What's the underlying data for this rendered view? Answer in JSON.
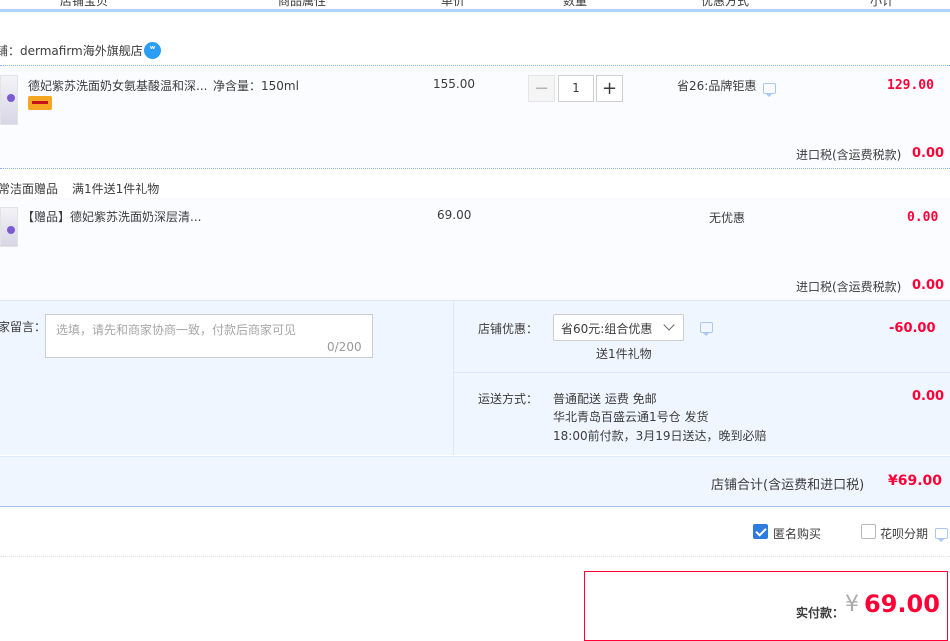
{
  "header": {
    "columns": [
      "店铺宝贝",
      "商品属性",
      "单价",
      "数量",
      "优惠方式",
      "小计"
    ]
  },
  "shop": {
    "label": "铺：dermafirm海外旗舰店",
    "wangwang_icon": "wangwang-chat-icon"
  },
  "items": [
    {
      "title": "德妃紫苏洗面奶女氨基酸温和深...",
      "spec": "净含量：150ml",
      "unit_price": "155.00",
      "quantity": "1",
      "promo": "省26:品牌钜惠",
      "subtotal": "129.00",
      "tax_label": "进口税(含运费税款)",
      "tax_value": "0.00"
    },
    {
      "group_label": "常洁面赠品",
      "group_rule": "满1件送1件礼物",
      "title": "【赠品】德妃紫苏洗面奶深层清...",
      "unit_price": "69.00",
      "promo": "无优惠",
      "subtotal": "0.00",
      "tax_label": "进口税(含运费税款)",
      "tax_value": "0.00"
    }
  ],
  "message": {
    "label": "家留言：",
    "placeholder": "选填，请先和商家协商一致，付款后商家可见",
    "count": "0/200"
  },
  "shop_discount": {
    "label": "店铺优惠：",
    "selected": "省60元:组合优惠",
    "note": "送1件礼物",
    "value": "-60.00"
  },
  "shipping": {
    "label": "运送方式：",
    "line1": "普通配送 运费 免邮",
    "line2": "华北青岛百盛云通1号仓   发货",
    "line3": "18:00前付款，3月19日送达，晚到必赔",
    "value": "0.00"
  },
  "shop_total": {
    "label": "店铺合计(含运费和进口税)",
    "value": "¥69.00"
  },
  "options": {
    "anonymous_label": "匿名购买",
    "anonymous_checked": true,
    "huabei_label": "花呗分期",
    "huabei_checked": false
  },
  "payment": {
    "label": "实付款：",
    "currency": "¥",
    "amount": "69.00"
  },
  "colors": {
    "accent_red": "#ff0036",
    "panel_blue": "#f0f6ff",
    "header_blue": "#b2d1ff",
    "checkbox_blue": "#2e7be0"
  }
}
